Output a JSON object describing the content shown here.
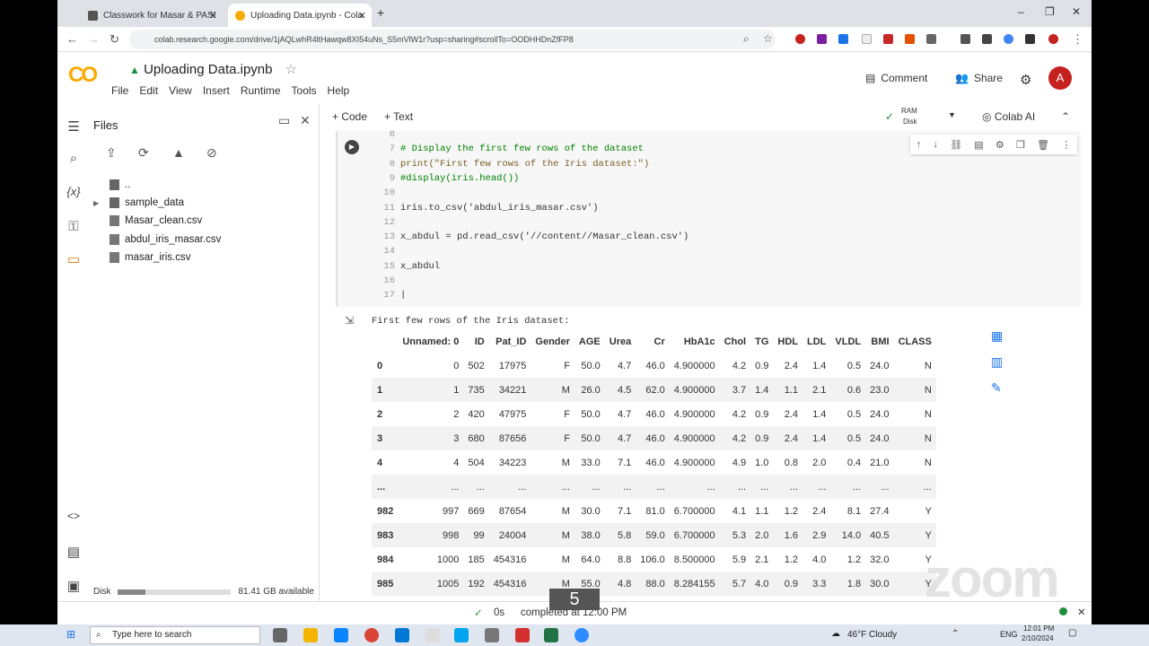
{
  "browser": {
    "tabs": [
      {
        "label": "Classwork for Masar & PASDS D",
        "active": false
      },
      {
        "label": "Uploading Data.ipynb - Colab",
        "active": true
      }
    ],
    "url": "colab.research.google.com/drive/1jAQLwhR4ltHawqw8XI54uNs_S5mVlW1r?usp=sharing#scrollTo=OODHHDnZfFP8"
  },
  "header": {
    "title": "Uploading Data.ipynb",
    "menu": [
      "File",
      "Edit",
      "View",
      "Insert",
      "Runtime",
      "Tools",
      "Help"
    ],
    "comment": "Comment",
    "share": "Share",
    "avatar": "A"
  },
  "sidebar": {
    "title": "Files",
    "items": [
      "..",
      "sample_data",
      "Masar_clean.csv",
      "abdul_iris_masar.csv",
      "masar_iris.csv"
    ],
    "disk_label": "Disk",
    "disk_available": "81.41 GB available",
    "disk_used_fraction": 0.24
  },
  "toolbar": {
    "code": "+ Code",
    "text": "+ Text",
    "ram": "RAM",
    "disk": "Disk",
    "colab_ai": "Colab AI"
  },
  "code": [
    {
      "n": "6",
      "t": "",
      "c": "plain"
    },
    {
      "n": "7",
      "t": "# Display the first few rows of the dataset",
      "c": "cmt"
    },
    {
      "n": "8",
      "t": "print(\"First few rows of the Iris dataset:\")",
      "c": "fn"
    },
    {
      "n": "9",
      "t": "#display(iris.head())",
      "c": "cmt"
    },
    {
      "n": "10",
      "t": "",
      "c": "plain"
    },
    {
      "n": "11",
      "t": "iris.to_csv('abdul_iris_masar.csv')",
      "c": "plain"
    },
    {
      "n": "12",
      "t": "",
      "c": "plain"
    },
    {
      "n": "13",
      "t": "x_abdul = pd.read_csv('//content//Masar_clean.csv')",
      "c": "plain"
    },
    {
      "n": "14",
      "t": "",
      "c": "plain"
    },
    {
      "n": "15",
      "t": "x_abdul",
      "c": "plain"
    },
    {
      "n": "16",
      "t": "",
      "c": "plain"
    },
    {
      "n": "17",
      "t": "|",
      "c": "plain"
    }
  ],
  "output": {
    "title": "First few rows of the Iris dataset:",
    "columns": [
      "",
      "Unnamed: 0",
      "ID",
      "Pat_ID",
      "Gender",
      "AGE",
      "Urea",
      "Cr",
      "HbA1c",
      "Chol",
      "TG",
      "HDL",
      "LDL",
      "VLDL",
      "BMI",
      "CLASS"
    ],
    "rows": [
      [
        "0",
        "0",
        "502",
        "17975",
        "F",
        "50.0",
        "4.7",
        "46.0",
        "4.900000",
        "4.2",
        "0.9",
        "2.4",
        "1.4",
        "0.5",
        "24.0",
        "N"
      ],
      [
        "1",
        "1",
        "735",
        "34221",
        "M",
        "26.0",
        "4.5",
        "62.0",
        "4.900000",
        "3.7",
        "1.4",
        "1.1",
        "2.1",
        "0.6",
        "23.0",
        "N"
      ],
      [
        "2",
        "2",
        "420",
        "47975",
        "F",
        "50.0",
        "4.7",
        "46.0",
        "4.900000",
        "4.2",
        "0.9",
        "2.4",
        "1.4",
        "0.5",
        "24.0",
        "N"
      ],
      [
        "3",
        "3",
        "680",
        "87656",
        "F",
        "50.0",
        "4.7",
        "46.0",
        "4.900000",
        "4.2",
        "0.9",
        "2.4",
        "1.4",
        "0.5",
        "24.0",
        "N"
      ],
      [
        "4",
        "4",
        "504",
        "34223",
        "M",
        "33.0",
        "7.1",
        "46.0",
        "4.900000",
        "4.9",
        "1.0",
        "0.8",
        "2.0",
        "0.4",
        "21.0",
        "N"
      ],
      [
        "...",
        "...",
        "...",
        "...",
        "...",
        "...",
        "...",
        "...",
        "...",
        "...",
        "...",
        "...",
        "...",
        "...",
        "...",
        "..."
      ],
      [
        "982",
        "997",
        "669",
        "87654",
        "M",
        "30.0",
        "7.1",
        "81.0",
        "6.700000",
        "4.1",
        "1.1",
        "1.2",
        "2.4",
        "8.1",
        "27.4",
        "Y"
      ],
      [
        "983",
        "998",
        "99",
        "24004",
        "M",
        "38.0",
        "5.8",
        "59.0",
        "6.700000",
        "5.3",
        "2.0",
        "1.6",
        "2.9",
        "14.0",
        "40.5",
        "Y"
      ],
      [
        "984",
        "1000",
        "185",
        "454316",
        "M",
        "64.0",
        "8.8",
        "106.0",
        "8.500000",
        "5.9",
        "2.1",
        "1.2",
        "4.0",
        "1.2",
        "32.0",
        "Y"
      ],
      [
        "985",
        "1005",
        "192",
        "454316",
        "M",
        "55.0",
        "4.8",
        "88.0",
        "8.284155",
        "5.7",
        "4.0",
        "0.9",
        "3.3",
        "1.8",
        "30.0",
        "Y"
      ]
    ]
  },
  "status": {
    "time": "0s",
    "text": "completed at 12:00 PM"
  },
  "overlay": {
    "counter": "5",
    "watermark": "zoom"
  },
  "taskbar": {
    "search": "Type here to search",
    "weather": "46°F  Cloudy",
    "lang": "ENG",
    "time": "12:01 PM",
    "date": "2/10/2024"
  }
}
